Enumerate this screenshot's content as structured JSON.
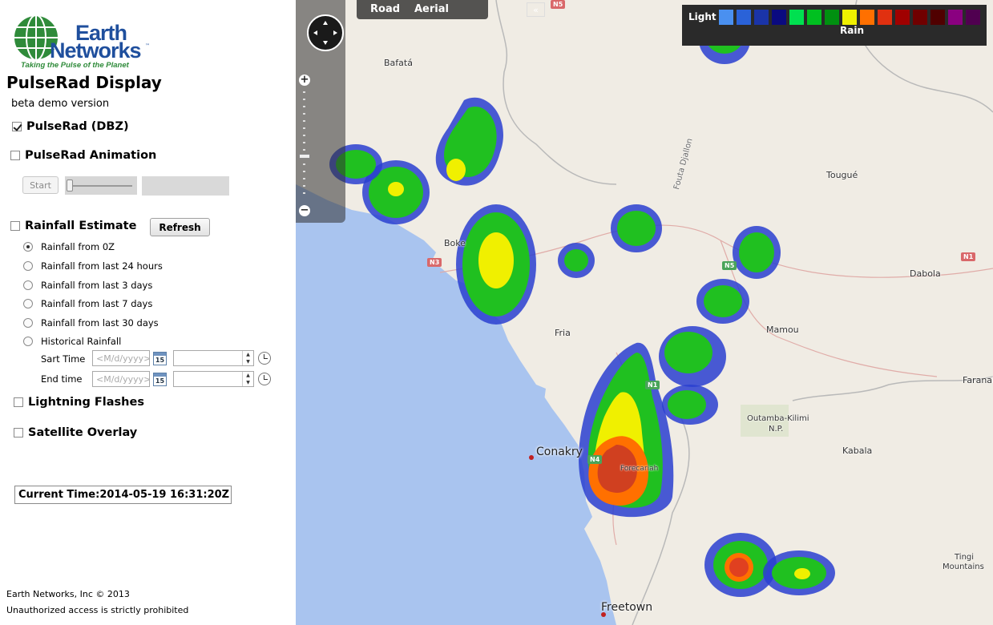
{
  "logo": {
    "line1": "Earth",
    "line2": "Networks",
    "trademark": "™",
    "tagline": "Taking the Pulse of the Planet"
  },
  "app": {
    "title": "PulseRad Display",
    "subtitle": "beta demo version"
  },
  "layers": {
    "pulserad": {
      "label": "PulseRad (DBZ)",
      "checked": true
    },
    "animation": {
      "label": "PulseRad Animation",
      "checked": false,
      "start_label": "Start"
    },
    "rainfall": {
      "label": "Rainfall Estimate",
      "checked": false,
      "refresh_label": "Refresh"
    },
    "lightning": {
      "label": "Lightning Flashes",
      "checked": false
    },
    "satellite": {
      "label": "Satellite Overlay",
      "checked": false
    }
  },
  "rainfall_options": [
    {
      "label": "Rainfall from 0Z",
      "selected": true
    },
    {
      "label": "Rainfall from last 24 hours",
      "selected": false
    },
    {
      "label": "Rainfall from last 3 days",
      "selected": false
    },
    {
      "label": "Rainfall from last 7 days",
      "selected": false
    },
    {
      "label": "Rainfall from last 30 days",
      "selected": false
    },
    {
      "label": "Historical Rainfall",
      "selected": false
    }
  ],
  "historical": {
    "start_label": "Sart Time",
    "end_label": "End time",
    "date_placeholder": "<M/d/yyyy>",
    "calendar_day": "15"
  },
  "current_time": "Current Time:2014-05-19 16:31:20Z",
  "footer": {
    "copyright": "Earth Networks, Inc © 2013",
    "notice": "Unauthorized access is strictly prohibited"
  },
  "map": {
    "types": [
      "Road",
      "Aerial"
    ],
    "collapse_icon": "«",
    "legend": {
      "light_label": "Light",
      "rain_label": "Rain",
      "colors": [
        "#4a90f0",
        "#2a62d8",
        "#1a34a8",
        "#0a0a80",
        "#00e050",
        "#00c020",
        "#009010",
        "#f0f000",
        "#ff7000",
        "#e03010",
        "#a00000",
        "#700000",
        "#500000",
        "#8a0080",
        "#500050"
      ]
    },
    "cities": [
      {
        "name": "Conakry"
      },
      {
        "name": "Freetown"
      }
    ],
    "places": [
      {
        "name": "Bafatá"
      },
      {
        "name": "Tougué"
      },
      {
        "name": "Dabola"
      },
      {
        "name": "Mamou"
      },
      {
        "name": "Fria"
      },
      {
        "name": "Boke"
      },
      {
        "name": "Faranah"
      },
      {
        "name": "Kabala"
      },
      {
        "name": "Outamba-Kilimi"
      },
      {
        "name": "N.P."
      },
      {
        "name": "Tingi"
      },
      {
        "name": "Mountains"
      },
      {
        "name": "Forecariah"
      },
      {
        "name": "Fouta Djallon"
      }
    ],
    "roads": [
      "N5",
      "N3",
      "N5",
      "N1",
      "N1",
      "N4"
    ]
  },
  "colors": {
    "brand_blue": "#1f4f9d",
    "brand_green": "#2f8b3a",
    "sea": "#a9c4ef",
    "land": "#f0ece4"
  }
}
